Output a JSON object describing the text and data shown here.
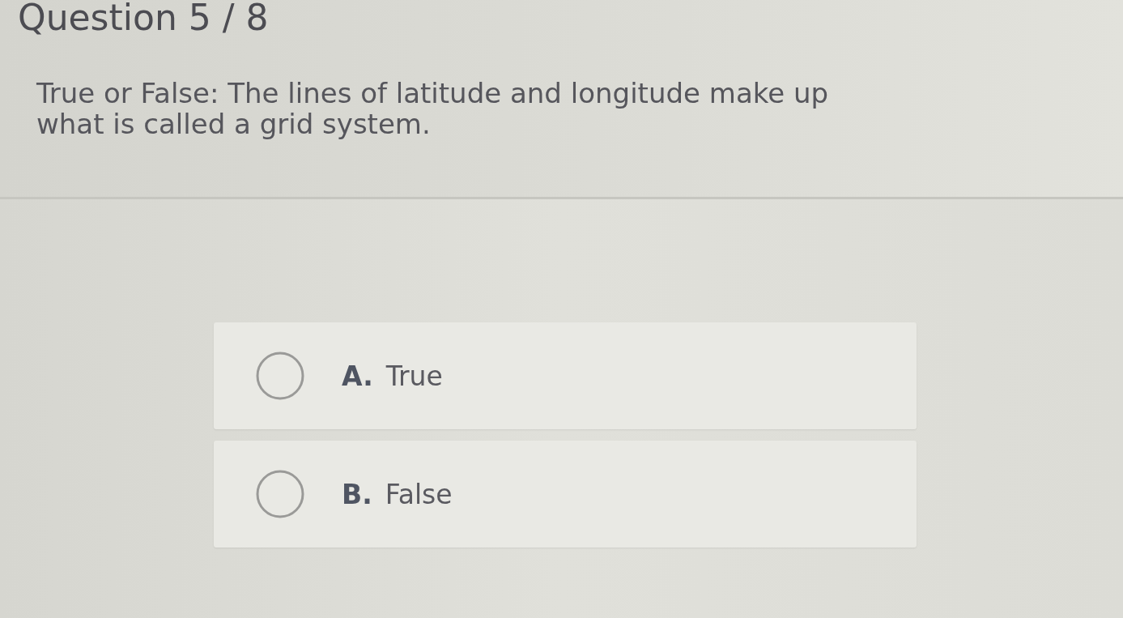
{
  "header": {
    "title": "Question 5 / 8"
  },
  "question": {
    "text": "True or False: The lines of latitude and longitude make up what is called a grid system."
  },
  "options": [
    {
      "letter": "A.",
      "text": "True",
      "selected": false
    },
    {
      "letter": "B.",
      "text": "False",
      "selected": false
    }
  ]
}
